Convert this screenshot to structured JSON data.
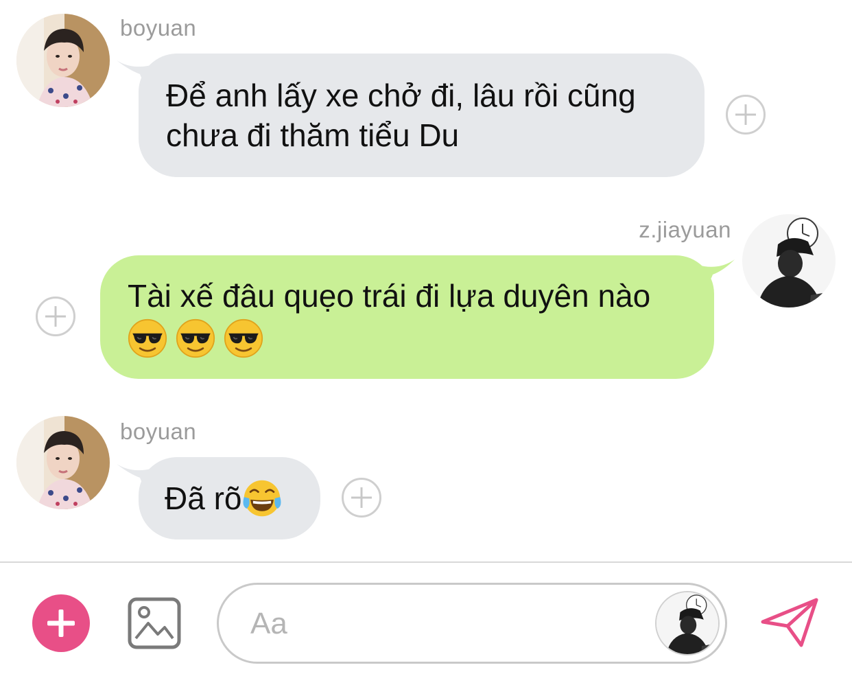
{
  "messages": [
    {
      "sender": "boyuan",
      "text": "Để anh lấy xe chở đi, lâu rồi cũng\nchưa đi thăm tiểu Du",
      "emojis": []
    },
    {
      "sender": "z.jiayuan",
      "text": "Tài xế đâu quẹo trái đi lựa duyên nào",
      "emojis": [
        "smiling-face-with-sunglasses",
        "smiling-face-with-sunglasses",
        "smiling-face-with-sunglasses"
      ]
    },
    {
      "sender": "boyuan",
      "text": "Đã rõ",
      "emojis": [
        "face-with-tears-of-joy"
      ]
    }
  ],
  "composer": {
    "placeholder": "Aa"
  },
  "icons": {
    "add": "plus-icon",
    "gallery": "image-icon",
    "send": "paper-plane-icon",
    "react": "plus-circle-icon"
  },
  "colors": {
    "incoming_bubble": "#e6e8eb",
    "outgoing_bubble": "#c9f096",
    "accent": "#e84f87",
    "sender_name": "#9b9b9b"
  }
}
